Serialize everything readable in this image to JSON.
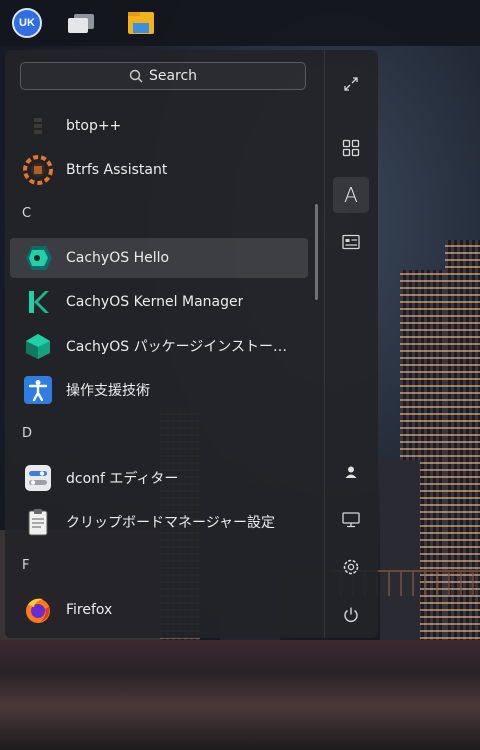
{
  "taskbar": {
    "uk_label": "UK",
    "icons": [
      "ukui-logo-icon",
      "windows-overview-icon",
      "file-manager-icon"
    ]
  },
  "search": {
    "placeholder": "Search"
  },
  "apps": [
    {
      "type": "app",
      "label": "btop++",
      "icon": "btop-icon"
    },
    {
      "type": "app",
      "label": "Btrfs Assistant",
      "icon": "btrfs-assistant-icon"
    },
    {
      "type": "section",
      "label": "C"
    },
    {
      "type": "app",
      "label": "CachyOS Hello",
      "icon": "cachyos-hello-icon",
      "selected": true
    },
    {
      "type": "app",
      "label": "CachyOS Kernel Manager",
      "icon": "cachyos-kernel-manager-icon"
    },
    {
      "type": "app",
      "label": "CachyOS パッケージインストー…",
      "icon": "cachyos-package-installer-icon"
    },
    {
      "type": "app",
      "label": "操作支援技術",
      "icon": "accessibility-icon"
    },
    {
      "type": "section",
      "label": "D"
    },
    {
      "type": "app",
      "label": "dconf エディター",
      "icon": "dconf-editor-icon"
    },
    {
      "type": "app",
      "label": "クリップボードマネージャー設定",
      "icon": "clipboard-manager-icon"
    },
    {
      "type": "section",
      "label": "F"
    },
    {
      "type": "app",
      "label": "Firefox",
      "icon": "firefox-icon"
    }
  ],
  "sidebar": {
    "top": [
      "fullscreen-icon",
      "all-apps-icon",
      "letter-sort-icon",
      "category-icon"
    ],
    "bottom": [
      "user-icon",
      "computer-icon",
      "settings-icon",
      "power-icon"
    ],
    "active": "letter-sort-icon",
    "letter_sort_glyph": "A"
  },
  "colors": {
    "accent": "#2f6fe0",
    "menu_bg": "#222328",
    "selection": "#3a3b40",
    "cachy_teal": "#1fd1a5",
    "btrfs_orange": "#e8732a"
  }
}
